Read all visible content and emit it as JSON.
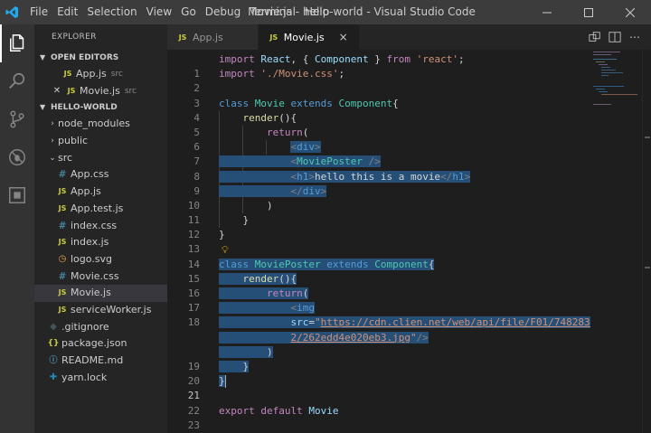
{
  "window": {
    "title": "Movie.js - hello-world - Visual Studio Code",
    "menu": [
      "File",
      "Edit",
      "Selection",
      "View",
      "Go",
      "Debug",
      "Terminal",
      "Help"
    ]
  },
  "activity_bar": [
    "files-icon",
    "search-icon",
    "source-control-icon",
    "debug-icon",
    "extensions-icon"
  ],
  "sidebar": {
    "title": "EXPLORER",
    "open_editors": {
      "header": "OPEN EDITORS",
      "items": [
        {
          "name": "App.js",
          "desc": "src",
          "icon": "JS"
        },
        {
          "name": "Movie.js",
          "desc": "src",
          "icon": "JS"
        }
      ]
    },
    "project": {
      "header": "HELLO-WORLD",
      "items": [
        {
          "name": "node_modules",
          "type": "folder",
          "state": "collapsed",
          "depth": 1
        },
        {
          "name": "public",
          "type": "folder",
          "state": "collapsed",
          "depth": 1
        },
        {
          "name": "src",
          "type": "folder",
          "state": "expanded",
          "depth": 1
        },
        {
          "name": "App.css",
          "type": "css",
          "depth": 2
        },
        {
          "name": "App.js",
          "type": "js",
          "depth": 2
        },
        {
          "name": "App.test.js",
          "type": "js",
          "depth": 2
        },
        {
          "name": "index.css",
          "type": "css",
          "depth": 2
        },
        {
          "name": "index.js",
          "type": "js",
          "depth": 2
        },
        {
          "name": "logo.svg",
          "type": "svg",
          "depth": 2
        },
        {
          "name": "Movie.css",
          "type": "css",
          "depth": 2
        },
        {
          "name": "Movie.js",
          "type": "js",
          "depth": 2,
          "active": true
        },
        {
          "name": "serviceWorker.js",
          "type": "js",
          "depth": 2
        },
        {
          "name": ".gitignore",
          "type": "git",
          "depth": 1
        },
        {
          "name": "package.json",
          "type": "json",
          "depth": 1
        },
        {
          "name": "README.md",
          "type": "md",
          "depth": 1
        },
        {
          "name": "yarn.lock",
          "type": "yarn",
          "depth": 1
        }
      ]
    }
  },
  "tabs": [
    {
      "label": "App.js",
      "icon": "JS",
      "active": false
    },
    {
      "label": "Movie.js",
      "icon": "JS",
      "active": true,
      "close": "×"
    }
  ],
  "editor": {
    "current_line": "21",
    "code_text": {
      "l1a": "import",
      "l1b": "React",
      "l1c": "Component",
      "l1d": "from",
      "l1e": "'react'",
      "l2a": "import",
      "l2b": "'./Movie.css'",
      "l4a": "class",
      "l4b": "Movie",
      "l4c": "extends",
      "l4d": "Component",
      "l5": "render",
      "l6": "return",
      "l7": "div",
      "l8": "MoviePoster",
      "l9a": "h1",
      "l9b": "hello this is a movie",
      "l15a": "class",
      "l15b": "MoviePoster",
      "l15c": "extends",
      "l15d": "Component",
      "l16": "render",
      "l17": "return",
      "l18a": "img",
      "l18b": "src",
      "l18c": "https://cdn.clien.net/web/api/file/F01/748283",
      "l18d": "2/262edd4e020eb3.jpg",
      "l23a": "export",
      "l23b": "default",
      "l23c": "Movie"
    },
    "line_numbers": [
      "1",
      "2",
      "3",
      "4",
      "5",
      "6",
      "7",
      "8",
      "9",
      "10",
      "11",
      "12",
      "13",
      "14",
      "15",
      "16",
      "17",
      "18",
      "",
      "19",
      "20",
      "21",
      "22",
      "23"
    ]
  }
}
